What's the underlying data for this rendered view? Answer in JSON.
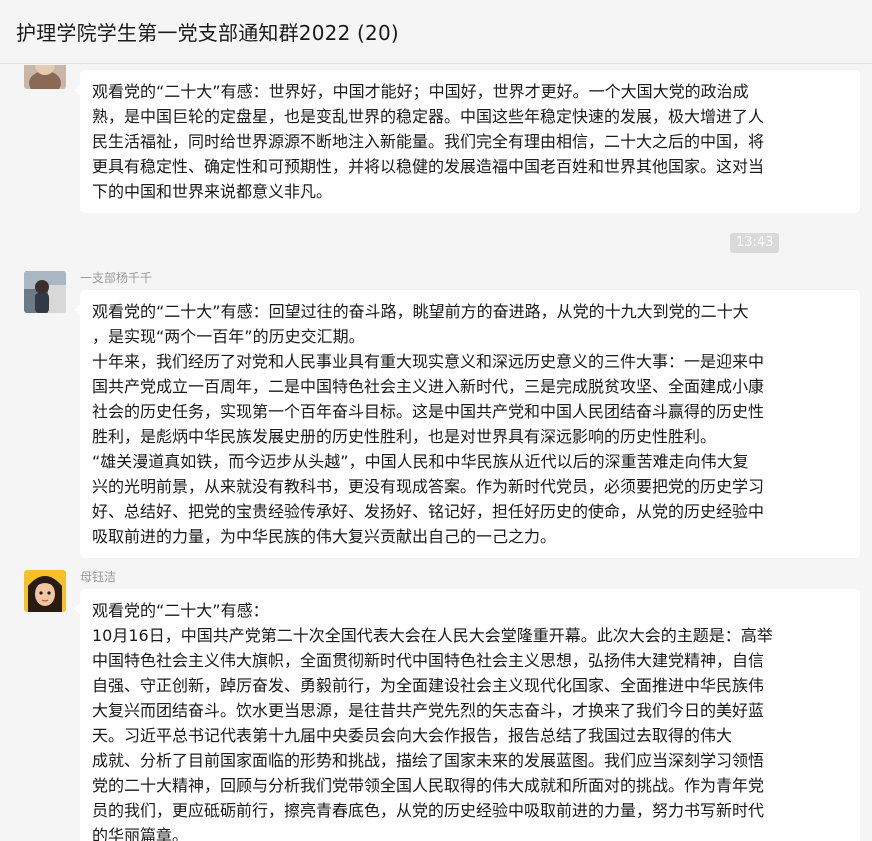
{
  "header": {
    "title": "护理学院学生第一党支部通知群2022 (20)"
  },
  "colors": {
    "background": "#f5f5f5",
    "bubble": "#ffffff",
    "timestamp_bg": "#dadada",
    "sender": "#9a9a9a"
  },
  "messages": [
    {
      "avatar": "user-avatar-photo",
      "lines": [
        "观看党的“二十大”有感：世界好，中国才能好；中国好，世界才更好。一个大国大党的政治成",
        "熟，是中国巨轮的定盘星，也是变乱世界的稳定器。中国这些年稳定快速的发展，极大增进了人",
        "民生活福祉，同时给世界源源不断地注入新能量。我们完全有理由相信，二十大之后的中国，将",
        "更具有稳定性、确定性和可预期性，并将以稳健的发展造福中国老百姓和世界其他国家。这对当",
        "下的中国和世界来说都意义非凡。"
      ]
    },
    {
      "timestamp": "13:43",
      "sender": "一支部杨千千",
      "lines": [
        "观看党的“二十大”有感：回望过往的奋斗路，眺望前方的奋进路，从党的十九大到党的二十大",
        "，是实现“两个一百年”的历史交汇期。",
        "十年来，我们经历了对党和人民事业具有重大现实意义和深远历史意义的三件大事：一是迎来中",
        "国共产党成立一百周年，二是中国特色社会主义进入新时代，三是完成脱贫攻坚、全面建成小康",
        "社会的历史任务，实现第一个百年奋斗目标。这是中国共产党和中国人民团结奋斗赢得的历史性",
        "胜利，是彪炳中华民族发展史册的历史性胜利，也是对世界具有深远影响的历史性胜利。",
        "“雄关漫道真如铁，而今迈步从头越”，中国人民和中华民族从近代以后的深重苦难走向伟大复",
        "兴的光明前景，从来就没有教科书，更没有现成答案。作为新时代党员，必须要把党的历史学习",
        "好、总结好、把党的宝贵经验传承好、发扬好、铭记好，担任好历史的使命，从党的历史经验中",
        "吸取前进的力量，为中华民族的伟大复兴贡献出自己的一己之力。"
      ]
    },
    {
      "sender": "母钰洁",
      "lines": [
        "观看党的“二十大”有感：",
        "10月16日，中国共产党第二十次全国代表大会在人民大会堂隆重开幕。此次大会的主题是：高举",
        "中国特色社会主义伟大旗帜，全面贯彻新时代中国特色社会主义思想，弘扬伟大建党精神，自信",
        "自强、守正创新，踔厉奋发、勇毅前行，为全面建设社会主义现代化国家、全面推进中华民族伟",
        "大复兴而团结奋斗。饮水更当思源，是往昔共产党先烈的矢志奋斗，才换来了我们今日的美好蓝",
        "天。习近平总书记代表第十九届中央委员会向大会作报告，报告总结了我国过去取得的伟大",
        "成就、分析了目前国家面临的形势和挑战，描绘了国家未来的发展蓝图。我们应当深刻学习领悟",
        "党的二十大精神，回顾与分析我们党带领全国人民取得的伟大成就和所面对的挑战。作为青年党",
        "员的我们，更应砥砺前行，擦亮青春底色，从党的历史经验中吸取前进的力量，努力书写新时代",
        "的华丽篇章。"
      ]
    }
  ]
}
